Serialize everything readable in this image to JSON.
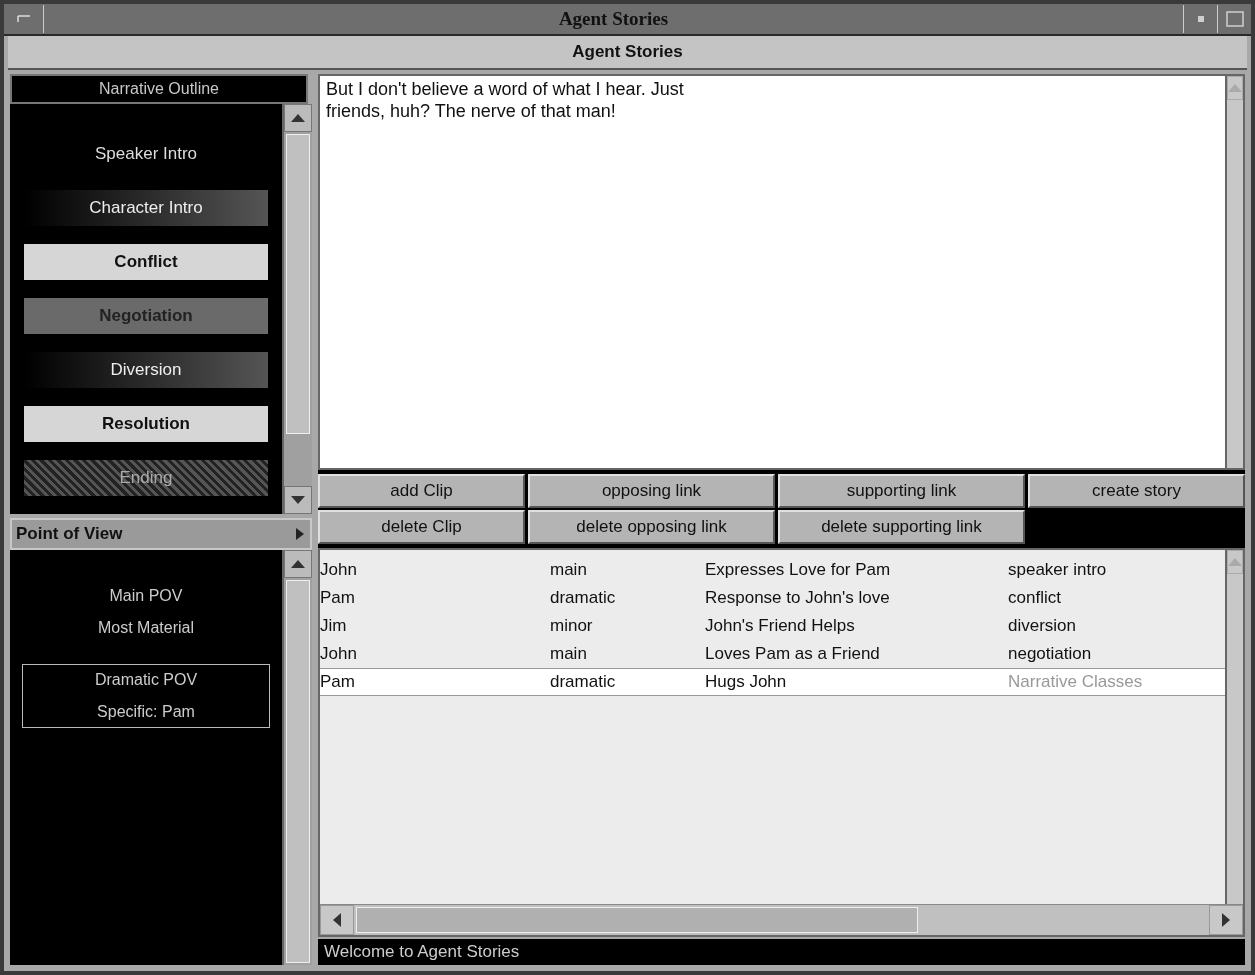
{
  "window": {
    "title": "Agent Stories"
  },
  "header": {
    "title": "Agent Stories"
  },
  "outline": {
    "title": "Narrative Outline",
    "items": [
      {
        "label": "Speaker Intro",
        "kind": "plain"
      },
      {
        "label": "Character Intro",
        "kind": "dark"
      },
      {
        "label": "Conflict",
        "kind": "light"
      },
      {
        "label": "Negotiation",
        "kind": "mid"
      },
      {
        "label": "Diversion",
        "kind": "dark"
      },
      {
        "label": "Resolution",
        "kind": "light"
      },
      {
        "label": "Ending",
        "kind": "hatched"
      }
    ]
  },
  "point_of_view": {
    "title": "Point of View",
    "groups": [
      {
        "lines": [
          "Main POV",
          "Most Material"
        ],
        "boxed": false
      },
      {
        "lines": [
          "Dramatic POV",
          "Specific: Pam"
        ],
        "boxed": true
      }
    ]
  },
  "clip_text": "But I don't believe a word of what I hear. Just friends, huh? The nerve of that man!",
  "buttons": [
    [
      "add Clip",
      "opposing link",
      "supporting link",
      "create story"
    ],
    [
      "delete Clip",
      "delete opposing link",
      "delete supporting link"
    ]
  ],
  "rows": [
    {
      "name": "John",
      "role": "main",
      "clip": "Expresses Love for Pam",
      "narrative_class": "speaker intro",
      "selected": false
    },
    {
      "name": "Pam",
      "role": "dramatic",
      "clip": "Response to John's love",
      "narrative_class": "conflict",
      "selected": false
    },
    {
      "name": "Jim",
      "role": "minor",
      "clip": "John's Friend Helps",
      "narrative_class": "diversion",
      "selected": false
    },
    {
      "name": "John",
      "role": "main",
      "clip": "Loves Pam as a Friend",
      "narrative_class": "negotiation",
      "selected": false
    },
    {
      "name": "Pam",
      "role": "dramatic",
      "clip": "Hugs John",
      "placeholder": "Narrative Classes",
      "selected": true
    }
  ],
  "status_bar": "Welcome to Agent Stories"
}
